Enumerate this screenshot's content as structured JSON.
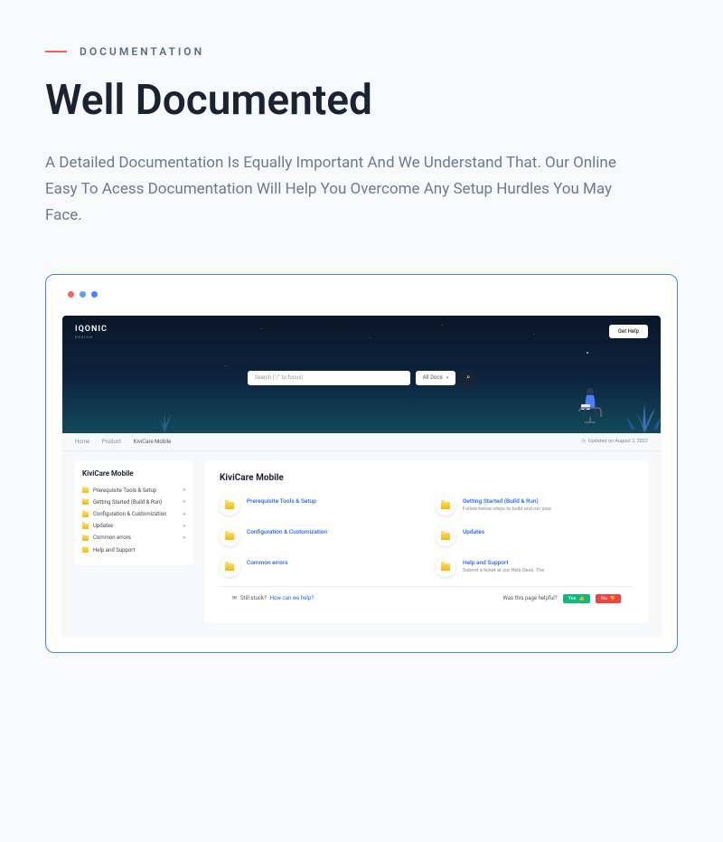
{
  "eyebrow": "DOCUMENTATION",
  "title": "Well Documented",
  "description": "A Detailed Documentation Is Equally Important And We Understand That. Our Online Easy To Acess Documentation Will Help You Overcome Any Setup Hurdles You May Face.",
  "doc": {
    "logo": "IQONIC",
    "logo_sub": "DESIGN",
    "get_help": "Get Help",
    "search_placeholder": "Search (\"/\" to focus)",
    "all_docs": "All Docs",
    "breadcrumbs": {
      "home": "Home",
      "product": "Product",
      "current": "KiviCare Mobile"
    },
    "updated_label": "Updated on August 2, 2022",
    "sidebar": {
      "title": "KiviCare Mobile",
      "items": [
        {
          "label": "Prerequisite Tools & Setup"
        },
        {
          "label": "Getting Started (Build & Run)"
        },
        {
          "label": "Configuration & Customization"
        },
        {
          "label": "Updates"
        },
        {
          "label": "Common errors"
        },
        {
          "label": "Help and Support"
        }
      ]
    },
    "content": {
      "title": "KiviCare Mobile",
      "cards": [
        {
          "title": "Prerequisite Tools & Setup",
          "desc": ""
        },
        {
          "title": "Getting Started (Build & Run)",
          "desc": "Follow below steps to build and run your"
        },
        {
          "title": "Configuration & Customization",
          "desc": ""
        },
        {
          "title": "Updates",
          "desc": ""
        },
        {
          "title": "Common errors",
          "desc": ""
        },
        {
          "title": "Help and Support",
          "desc": "Submit a ticket at our Help Desk. The"
        }
      ]
    },
    "footer": {
      "stuck": "Still stuck?",
      "stuck_link": "How can we help?",
      "helpful": "Was this page helpful?",
      "yes": "Yes",
      "no": "No"
    }
  }
}
